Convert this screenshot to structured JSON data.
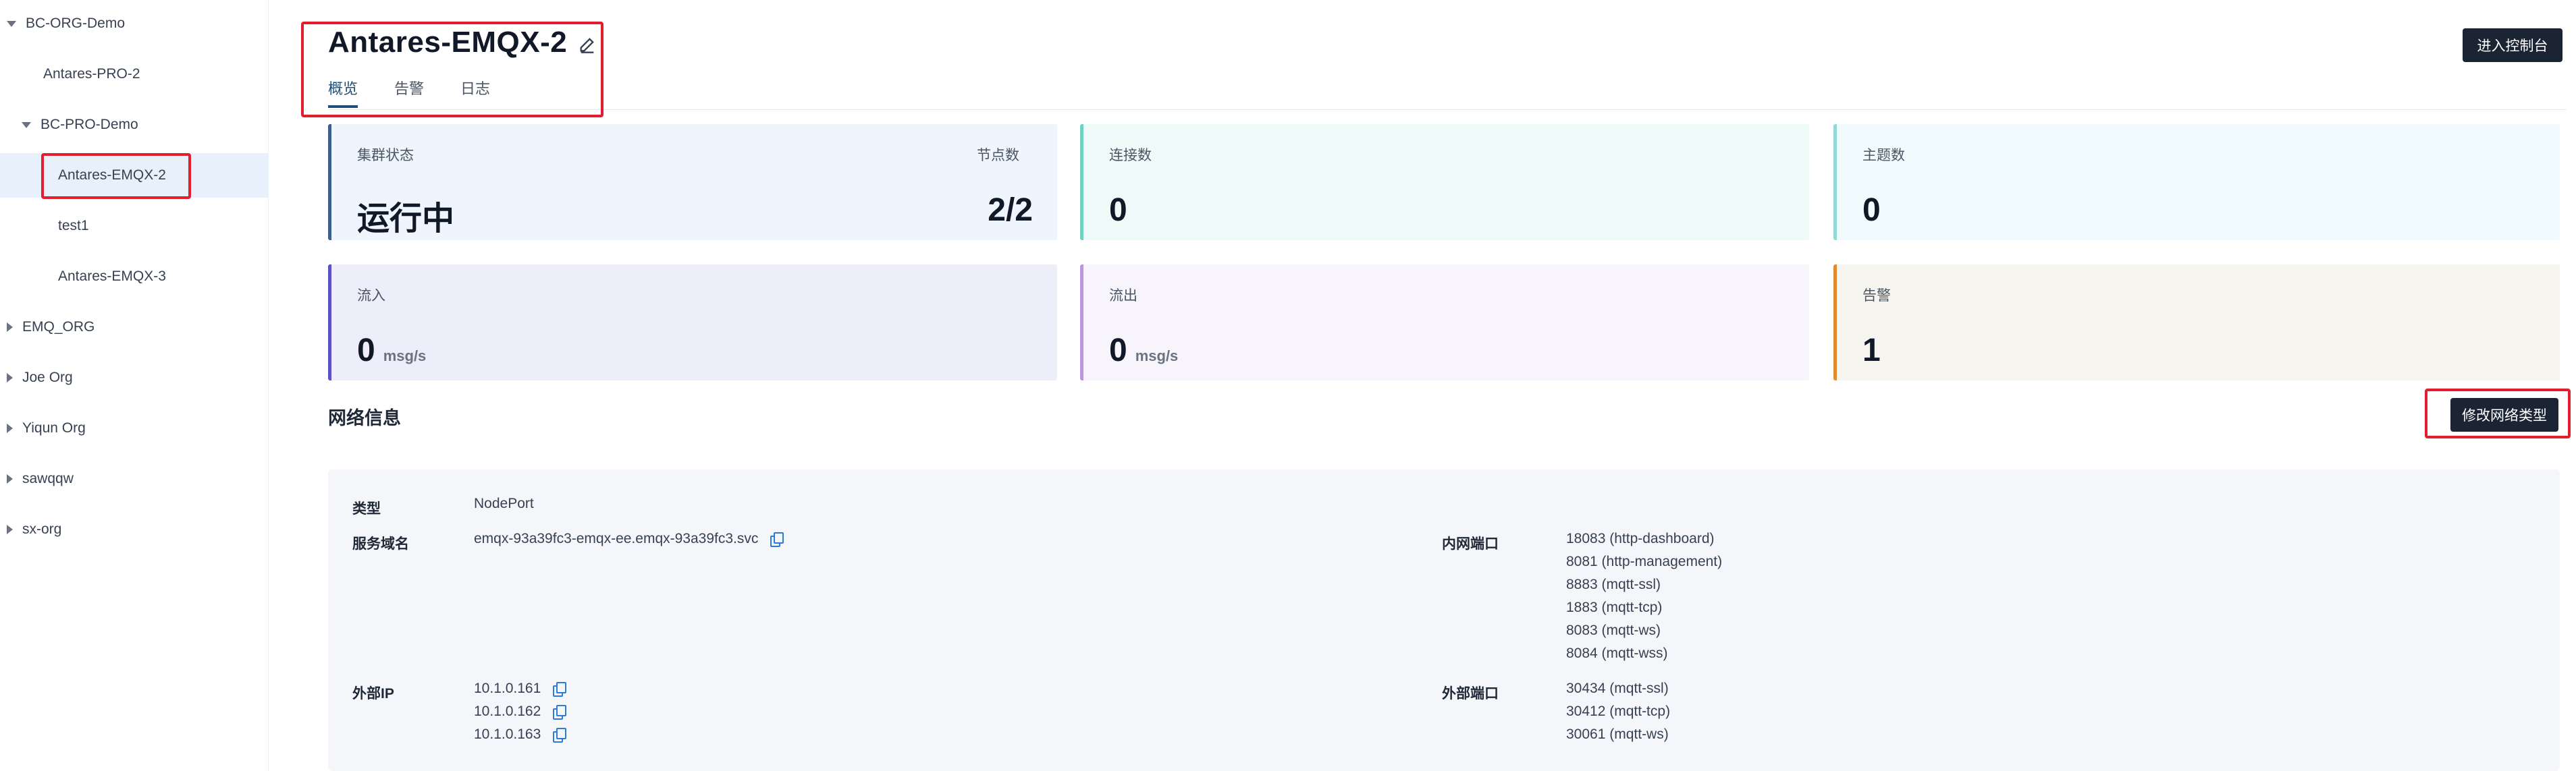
{
  "sidebar": {
    "items": [
      {
        "label": "BC-ORG-Demo",
        "caret": "down"
      },
      {
        "label": "Antares-PRO-2",
        "caret": "none"
      },
      {
        "label": "BC-PRO-Demo",
        "caret": "down"
      },
      {
        "label": "Antares-EMQX-2",
        "caret": "none",
        "selected": true
      },
      {
        "label": "test1",
        "caret": "none"
      },
      {
        "label": "Antares-EMQX-3",
        "caret": "none"
      },
      {
        "label": "EMQ_ORG",
        "caret": "right"
      },
      {
        "label": "Joe Org",
        "caret": "right"
      },
      {
        "label": "Yiqun Org",
        "caret": "right"
      },
      {
        "label": "sawqqw",
        "caret": "right"
      },
      {
        "label": "sx-org",
        "caret": "right"
      }
    ]
  },
  "header": {
    "title": "Antares-EMQX-2",
    "edit_icon": "pencil-icon",
    "console_button": "进入控制台",
    "tabs": [
      {
        "label": "概览",
        "active": true
      },
      {
        "label": "告警",
        "active": false
      },
      {
        "label": "日志",
        "active": false
      }
    ]
  },
  "cards": {
    "cluster": {
      "label": "集群状态",
      "value": "运行中",
      "nodes_label": "节点数",
      "nodes_value": "2/2",
      "bg": "#eef5fd",
      "accent": "#3a5f8f"
    },
    "connections": {
      "label": "连接数",
      "value": "0",
      "bg": "#eefaf7",
      "accent": "#6fd3bf"
    },
    "topics": {
      "label": "主题数",
      "value": "0",
      "bg": "#f1fbfd",
      "accent": "#8fdad6"
    },
    "inflow": {
      "label": "流入",
      "value": "0",
      "unit": "msg/s",
      "bg": "#eeedfa",
      "accent": "#5b51c6"
    },
    "outflow": {
      "label": "流出",
      "value": "0",
      "unit": "msg/s",
      "bg": "#f7f4fc",
      "accent": "#b89ad8"
    },
    "alarms": {
      "label": "告警",
      "value": "1",
      "bg": "#f7f5ef",
      "accent": "#e38a2f"
    }
  },
  "network": {
    "title": "网络信息",
    "edit_button": "修改网络类型",
    "type_label": "类型",
    "type_value": "NodePort",
    "domain_label": "服务域名",
    "domain_value": "emqx-93a39fc3-emqx-ee.emqx-93a39fc3.svc",
    "internal_ports_label": "内网端口",
    "internal_ports": [
      "18083 (http-dashboard)",
      "8081 (http-management)",
      "8883 (mqtt-ssl)",
      "1883 (mqtt-tcp)",
      "8083 (mqtt-ws)",
      "8084 (mqtt-wss)"
    ],
    "external_ip_label": "外部IP",
    "external_ips": [
      "10.1.0.161",
      "10.1.0.162",
      "10.1.0.163"
    ],
    "external_ports_label": "外部端口",
    "external_ports": [
      "30434 (mqtt-ssl)",
      "30412 (mqtt-tcp)",
      "30061 (mqtt-ws)"
    ]
  }
}
